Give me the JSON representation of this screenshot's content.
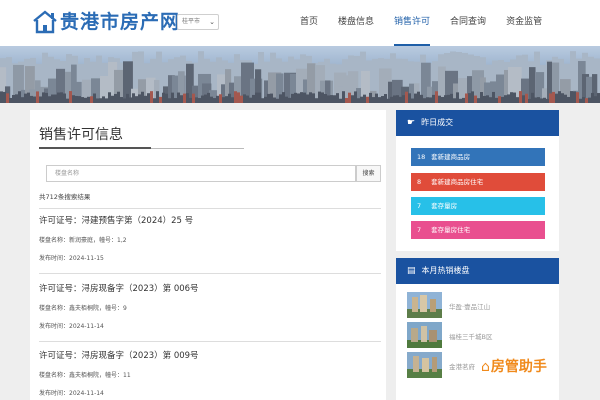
{
  "header": {
    "logo_text": "贵港市房产网",
    "city_select": "桂平市",
    "nav": [
      "首页",
      "楼盘信息",
      "销售许可",
      "合同查询",
      "资金监管"
    ],
    "active_nav": 2
  },
  "main": {
    "title": "销售许可信息",
    "search_placeholder": "楼盘名称",
    "search_button": "搜索",
    "result_count": "共712条搜索结果",
    "permits": [
      {
        "title": "许可证号：浔建预售字第（2024）25 号",
        "info": "楼盘名称：新润豪庭，幢号：1,2",
        "date": "发布时间：2024-11-15"
      },
      {
        "title": "许可证号：浔房现备字（2023）第 006号",
        "info": "楼盘名称：鑫夫栢桐院，幢号：9",
        "date": "发布时间：2024-11-14"
      },
      {
        "title": "许可证号：浔房现备字（2023）第 009号",
        "info": "楼盘名称：鑫夫栢桐院，幢号：11",
        "date": "发布时间：2024-11-14"
      }
    ]
  },
  "sidebar": {
    "yesterday_title": "昨日成交",
    "stats": [
      {
        "num": "18",
        "label": "套新建商品房",
        "color": "#3274b9"
      },
      {
        "num": "8",
        "label": "套新建商品房住宅",
        "color": "#e04c3a"
      },
      {
        "num": "7",
        "label": "套存量房",
        "color": "#27c0e8"
      },
      {
        "num": "7",
        "label": "套存量房住宅",
        "color": "#e94f8f"
      }
    ],
    "hot_title": "本月热销楼盘",
    "hot": [
      "华盈·壹品江山",
      "福桂三千城B区",
      "金港茗府"
    ]
  },
  "watermark": "房管助手",
  "colors": {
    "brand": "#2b6cb5",
    "sidebar_header": "#1a52a0"
  }
}
